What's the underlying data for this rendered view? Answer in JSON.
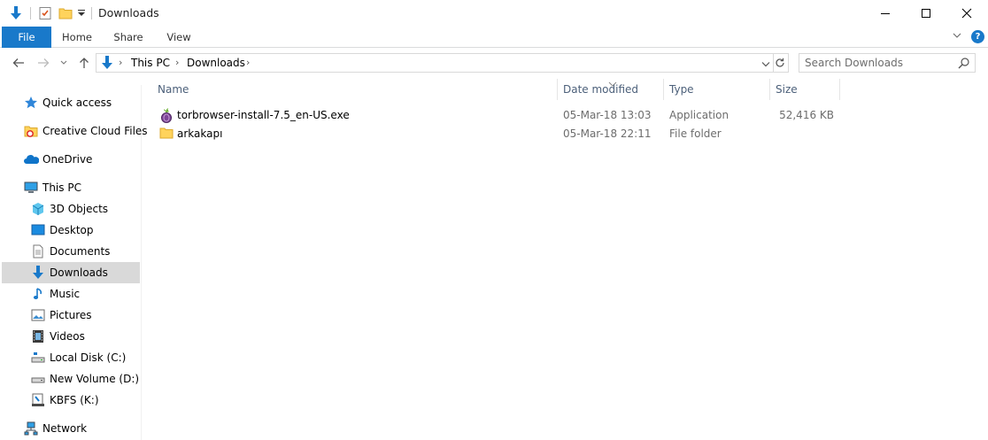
{
  "window": {
    "title": "Downloads",
    "controls": {
      "minimize": "—",
      "maximize": "☐",
      "close": "✕"
    }
  },
  "ribbon": {
    "tabs": [
      {
        "label": "File"
      },
      {
        "label": "Home"
      },
      {
        "label": "Share"
      },
      {
        "label": "View"
      }
    ],
    "help": "?"
  },
  "address": {
    "crumbs": [
      "This PC",
      "Downloads"
    ]
  },
  "search": {
    "placeholder": "Search Downloads"
  },
  "nav": {
    "items": [
      {
        "label": "Quick access",
        "icon": "star-icon"
      },
      {
        "label": "Creative Cloud Files",
        "icon": "creative-cloud-icon"
      },
      {
        "label": "OneDrive",
        "icon": "onedrive-icon"
      },
      {
        "label": "This PC",
        "icon": "monitor-icon"
      },
      {
        "label": "3D Objects",
        "icon": "cube-icon"
      },
      {
        "label": "Desktop",
        "icon": "desktop-icon"
      },
      {
        "label": "Documents",
        "icon": "document-icon"
      },
      {
        "label": "Downloads",
        "icon": "download-icon",
        "selected": true
      },
      {
        "label": "Music",
        "icon": "music-icon"
      },
      {
        "label": "Pictures",
        "icon": "pictures-icon"
      },
      {
        "label": "Videos",
        "icon": "video-icon"
      },
      {
        "label": "Local Disk (C:)",
        "icon": "local-disk-icon"
      },
      {
        "label": "New Volume (D:)",
        "icon": "drive-icon"
      },
      {
        "label": "KBFS (K:)",
        "icon": "network-drive-icon"
      },
      {
        "label": "Network",
        "icon": "network-icon"
      }
    ]
  },
  "columns": {
    "name": "Name",
    "date": "Date modified",
    "type": "Type",
    "size": "Size"
  },
  "files": [
    {
      "name": "torbrowser-install-7.5_en-US.exe",
      "date": "05-Mar-18 13:03",
      "type": "Application",
      "size": "52,416 KB",
      "icon": "tor-app-icon"
    },
    {
      "name": "arkakapı",
      "date": "05-Mar-18 22:11",
      "type": "File folder",
      "size": "",
      "icon": "folder-icon"
    }
  ],
  "colors": {
    "accent": "#1979ca",
    "selection": "#d9d9d9",
    "header_text": "#4c607a",
    "detail_text": "#6d6d6d"
  }
}
